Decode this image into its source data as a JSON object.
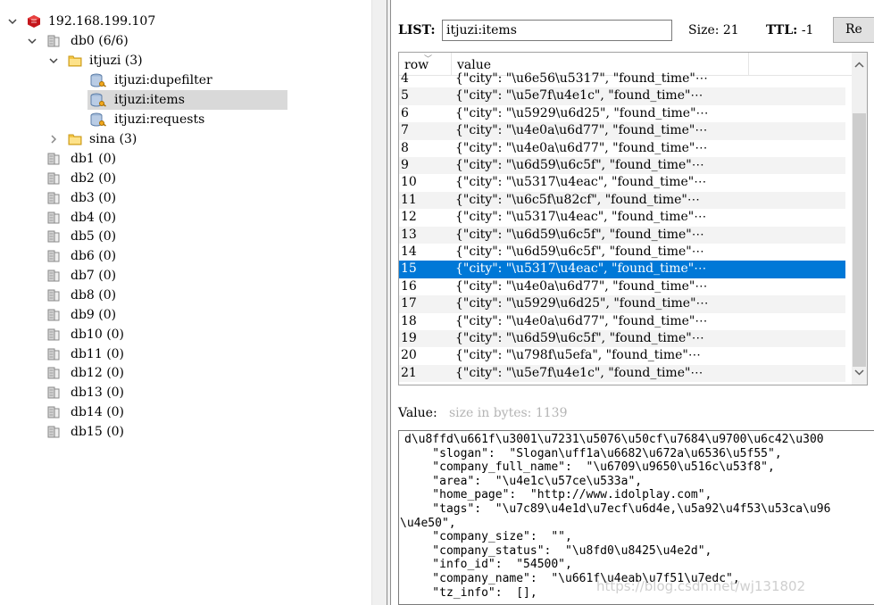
{
  "tree": {
    "server": {
      "label": "192.168.199.107"
    },
    "db0": {
      "label": "db0  (6/6)"
    },
    "folder_itjuzi": {
      "label": "itjuzi (3)"
    },
    "keys": [
      {
        "label": "itjuzi:dupefilter"
      },
      {
        "label": "itjuzi:items"
      },
      {
        "label": "itjuzi:requests"
      }
    ],
    "folder_sina": {
      "label": "sina (3)"
    },
    "dbs": [
      {
        "label": "db1 (0)"
      },
      {
        "label": "db2 (0)"
      },
      {
        "label": "db3 (0)"
      },
      {
        "label": "db4 (0)"
      },
      {
        "label": "db5 (0)"
      },
      {
        "label": "db6 (0)"
      },
      {
        "label": "db7 (0)"
      },
      {
        "label": "db8 (0)"
      },
      {
        "label": "db9 (0)"
      },
      {
        "label": "db10 (0)"
      },
      {
        "label": "db11 (0)"
      },
      {
        "label": "db12 (0)"
      },
      {
        "label": "db13 (0)"
      },
      {
        "label": "db14 (0)"
      },
      {
        "label": "db15 (0)"
      }
    ]
  },
  "header": {
    "list_label": "LIST:",
    "key_value": "itjuzi:items",
    "size_text": "Size: 21",
    "ttl_label": "TTL:",
    "ttl_value": "-1",
    "rename_label": "Re"
  },
  "table": {
    "columns": [
      "row",
      "value"
    ],
    "rows": [
      {
        "row": "4",
        "value": "{\"city\": \"\\u6e56\\u5317\", \"found_time\"⋯"
      },
      {
        "row": "5",
        "value": "{\"city\": \"\\u5e7f\\u4e1c\", \"found_time\"⋯"
      },
      {
        "row": "6",
        "value": "{\"city\": \"\\u5929\\u6d25\", \"found_time\"⋯"
      },
      {
        "row": "7",
        "value": "{\"city\": \"\\u4e0a\\u6d77\", \"found_time\"⋯"
      },
      {
        "row": "8",
        "value": "{\"city\": \"\\u4e0a\\u6d77\", \"found_time\"⋯"
      },
      {
        "row": "9",
        "value": "{\"city\": \"\\u6d59\\u6c5f\", \"found_time\"⋯"
      },
      {
        "row": "10",
        "value": "{\"city\": \"\\u5317\\u4eac\", \"found_time\"⋯"
      },
      {
        "row": "11",
        "value": "{\"city\": \"\\u6c5f\\u82cf\", \"found_time\"⋯"
      },
      {
        "row": "12",
        "value": "{\"city\": \"\\u5317\\u4eac\", \"found_time\"⋯"
      },
      {
        "row": "13",
        "value": "{\"city\": \"\\u6d59\\u6c5f\", \"found_time\"⋯"
      },
      {
        "row": "14",
        "value": "{\"city\": \"\\u6d59\\u6c5f\", \"found_time\"⋯"
      },
      {
        "row": "15",
        "value": "{\"city\": \"\\u5317\\u4eac\", \"found_time\"⋯"
      },
      {
        "row": "16",
        "value": "{\"city\": \"\\u4e0a\\u6d77\", \"found_time\"⋯"
      },
      {
        "row": "17",
        "value": "{\"city\": \"\\u5929\\u6d25\", \"found_time\"⋯"
      },
      {
        "row": "18",
        "value": "{\"city\": \"\\u4e0a\\u6d77\", \"found_time\"⋯"
      },
      {
        "row": "19",
        "value": "{\"city\": \"\\u6d59\\u6c5f\", \"found_time\"⋯"
      },
      {
        "row": "20",
        "value": "{\"city\": \"\\u798f\\u5efa\", \"found_time\"⋯"
      },
      {
        "row": "21",
        "value": "{\"city\": \"\\u5e7f\\u4e1c\", \"found_time\"⋯"
      }
    ],
    "selected_row": "15"
  },
  "value_panel": {
    "label": "Value:",
    "hint": "size in bytes: 1139",
    "lines": [
      "d\\u8ffd\\u661f\\u3001\\u7231\\u5076\\u50cf\\u7684\\u9700\\u6c42\\u300",
      "    \"slogan\":  \"Slogan\\uff1a\\u6682\\u672a\\u6536\\u5f55\",",
      "    \"company_full_name\":  \"\\u6709\\u9650\\u516c\\u53f8\",",
      "    \"area\":  \"\\u4e1c\\u57ce\\u533a\",",
      "    \"home_page\":  \"http://www.idolplay.com\",",
      "    \"tags\":  \"\\u7c89\\u4e1d\\u7ecf\\u6d4e,\\u5a92\\u4f53\\u53ca\\u96",
      "\\u4e50\",",
      "    \"company_size\":  \"\",",
      "    \"company_status\":  \"\\u8fd0\\u8425\\u4e2d\",",
      "    \"info_id\":  \"54500\",",
      "    \"company_name\":  \"\\u661f\\u4eab\\u7f51\\u7edc\",",
      "    \"tz_info\":  [],"
    ]
  },
  "watermark": "https://blog.csdn.net/wj131802",
  "colors": {
    "selection": "#0078d7",
    "tree_selection": "#d9d9d9"
  }
}
